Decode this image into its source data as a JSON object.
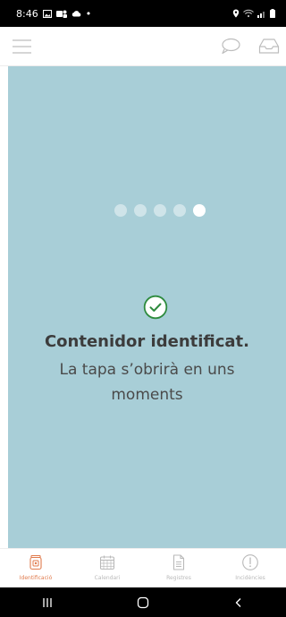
{
  "status_bar": {
    "time": "8:46",
    "dot": "•"
  },
  "header": {
    "menu_icon": "hamburger-menu-icon",
    "chat_icon": "chat-bubble-icon",
    "inbox_icon": "inbox-tray-icon"
  },
  "main": {
    "background_color": "#a8ced7",
    "loading_dots_total": 5,
    "title": "Contenidor identificat.",
    "message": "La tapa s’obrirà en uns moments",
    "check_icon_color": "#2e8b3e"
  },
  "tabs": [
    {
      "label": "Identificació",
      "icon": "trash-bin-icon",
      "active": true
    },
    {
      "label": "Calendari",
      "icon": "calendar-icon",
      "active": false
    },
    {
      "label": "Registres",
      "icon": "document-icon",
      "active": false
    },
    {
      "label": "Incidències",
      "icon": "alert-circle-icon",
      "active": false
    }
  ],
  "colors": {
    "accent": "#e07a4c",
    "inactive": "#b9b9b9"
  }
}
